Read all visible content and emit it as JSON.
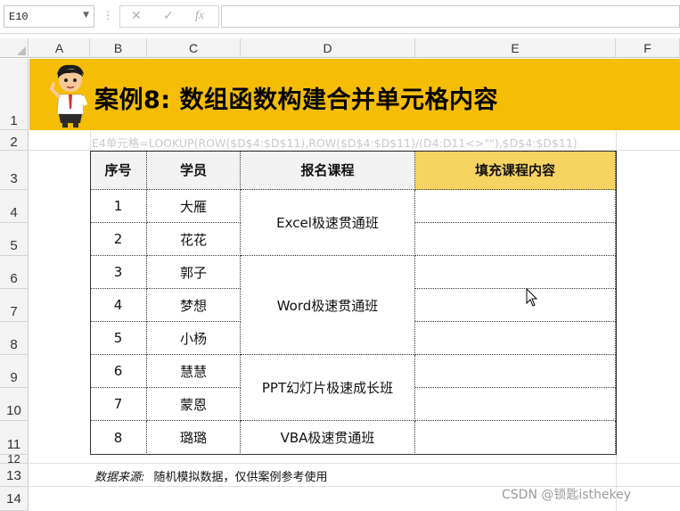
{
  "formula_bar": {
    "name_box": "E10",
    "cancel_icon": "✕",
    "enter_icon": "✓",
    "fx_label": "fx",
    "formula": ""
  },
  "columns": [
    "A",
    "B",
    "C",
    "D",
    "E",
    "F"
  ],
  "rows": [
    "1",
    "2",
    "3",
    "4",
    "5",
    "6",
    "7",
    "8",
    "9",
    "10",
    "11",
    "12",
    "13",
    "14"
  ],
  "banner": {
    "title": "案例8: 数组函数构建合并单元格内容",
    "color": "#f5bd04"
  },
  "formula_note": "E4单元格=LOOKUP(ROW($D$4:$D$11),ROW($D$4:$D$11)/(D4:D11<>\"\"),$D$4:$D$11)",
  "table": {
    "headers": [
      "序号",
      "学员",
      "报名课程",
      "填充课程内容"
    ],
    "header_fill": "#f2f2f2",
    "highlight_fill": "#f7d461",
    "rows": [
      {
        "no": "1",
        "name": "大雁"
      },
      {
        "no": "2",
        "name": "花花"
      },
      {
        "no": "3",
        "name": "郭子"
      },
      {
        "no": "4",
        "name": "梦想"
      },
      {
        "no": "5",
        "name": "小杨"
      },
      {
        "no": "6",
        "name": "慧慧"
      },
      {
        "no": "7",
        "name": "蒙恩"
      },
      {
        "no": "8",
        "name": "璐璐"
      }
    ],
    "courses": [
      "Excel极速贯通班",
      "Word极速贯通班",
      "PPT幻灯片极速成长班",
      "VBA极速贯通班"
    ]
  },
  "source": {
    "label": "数据来源:",
    "text": "随机模拟数据，仅供案例参考使用"
  },
  "watermark": "CSDN @锁匙isthekey"
}
